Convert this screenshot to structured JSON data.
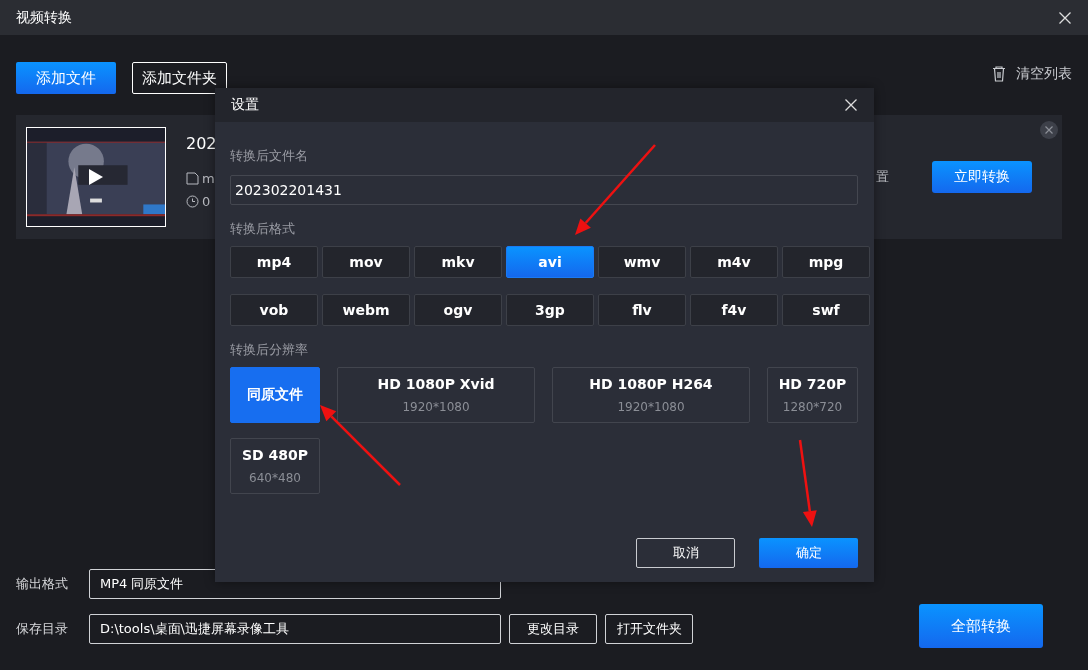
{
  "window": {
    "title": "视频转换"
  },
  "toolbar": {
    "buttons": [
      {
        "label": "添加文件",
        "kind": "primary"
      },
      {
        "label": "添加文件夹",
        "kind": "outline"
      }
    ],
    "clear_list": "清空列表"
  },
  "file_card": {
    "name": "202",
    "format": "m",
    "duration": "0",
    "settings_text": "置",
    "convert_button": "立即转换"
  },
  "output": {
    "format_label": "输出格式",
    "format_value": "MP4 同原文件",
    "dir_label": "保存目录",
    "dir_value": "D:\\tools\\桌面\\迅捷屏幕录像工具",
    "buttons": [
      "更改目录",
      "打开文件夹"
    ],
    "convert_all": "全部转换"
  },
  "dialog": {
    "title": "设置",
    "filename_label": "转换后文件名",
    "filename": "202302201431",
    "format_label": "转换后格式",
    "formats": [
      {
        "label": "mp4",
        "selected": false
      },
      {
        "label": "mov",
        "selected": false
      },
      {
        "label": "mkv",
        "selected": false
      },
      {
        "label": "avi",
        "selected": true
      },
      {
        "label": "wmv",
        "selected": false
      },
      {
        "label": "m4v",
        "selected": false
      },
      {
        "label": "mpg",
        "selected": false
      },
      {
        "label": "vob",
        "selected": false
      },
      {
        "label": "webm",
        "selected": false
      },
      {
        "label": "ogv",
        "selected": false
      },
      {
        "label": "3gp",
        "selected": false
      },
      {
        "label": "flv",
        "selected": false
      },
      {
        "label": "f4v",
        "selected": false
      },
      {
        "label": "swf",
        "selected": false
      }
    ],
    "resolution_label": "转换后分辨率",
    "resolutions": [
      {
        "name": "同原文件",
        "selected": true
      },
      {
        "name": "HD 1080P Xvid",
        "size": "1920*1080",
        "selected": false
      },
      {
        "name": "HD 1080P H264",
        "size": "1920*1080",
        "selected": false
      },
      {
        "name": "HD 720P",
        "size": "1280*720",
        "selected": false
      },
      {
        "name": "SD 480P",
        "size": "640*480",
        "selected": false
      }
    ],
    "buttons": [
      {
        "label": "取消",
        "kind": "secondary"
      },
      {
        "label": "确定",
        "kind": "primary"
      }
    ]
  },
  "annotations": [
    {
      "kind": "arrow"
    },
    {
      "kind": "arrow"
    },
    {
      "kind": "arrow"
    }
  ]
}
